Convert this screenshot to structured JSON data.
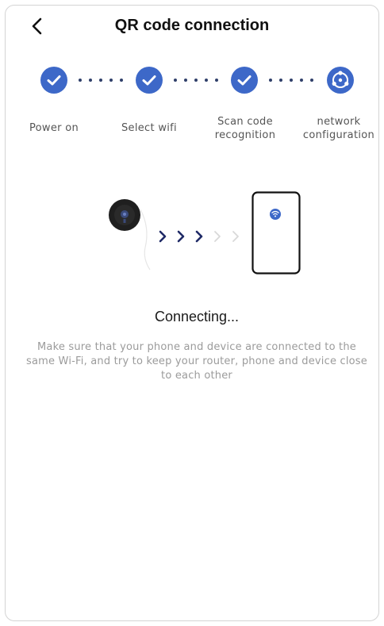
{
  "header": {
    "title": "QR code connection",
    "back_icon": "chevron-left-icon"
  },
  "stepper": {
    "accent_color": "#3d68c8",
    "steps": [
      {
        "label": "Power on",
        "status": "done",
        "icon": "check-icon"
      },
      {
        "label": "Select wifi",
        "status": "done",
        "icon": "check-icon"
      },
      {
        "label": "Scan code recognition",
        "status": "done",
        "icon": "check-icon"
      },
      {
        "label": "network configuration",
        "status": "current",
        "icon": "network-config-icon"
      }
    ]
  },
  "illustration": {
    "device_icon": "camera-device-icon",
    "phone_icon": "smartphone-icon",
    "phone_signal_icon": "wifi-icon",
    "transfer_icon": "chevrons-right-icon"
  },
  "status": {
    "text": "Connecting...",
    "hint": "Make sure that your phone and device are connected to the same Wi-Fi, and try to keep your router, phone and device close to each other"
  }
}
